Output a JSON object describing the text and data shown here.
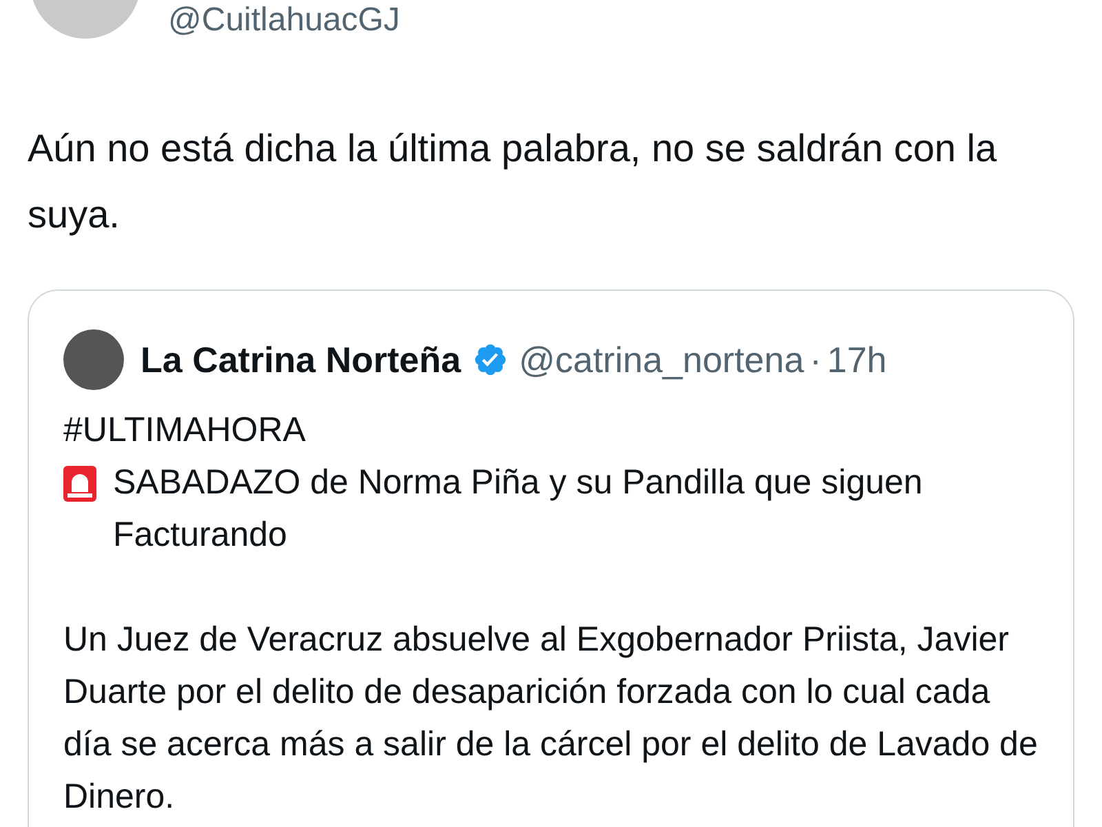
{
  "author": {
    "handle": "@CuitlahuacGJ"
  },
  "tweet_text": "Aún no está dicha la última palabra, no se saldrán con la suya.",
  "quoted": {
    "name": "La Catrina Norteña",
    "verified": true,
    "handle": "@catrina_nortena",
    "separator": "·",
    "time": "17h",
    "paragraphs": [
      {
        "kind": "text",
        "text": "#ULTIMAHORA"
      },
      {
        "kind": "siren",
        "text": "SABADAZO de Norma Piña y su Pandilla que siguen Facturando"
      },
      {
        "kind": "spacer"
      },
      {
        "kind": "text",
        "text": "Un Juez de Veracruz absuelve al Exgobernador Priista, Javier Duarte por el delito de desaparición forzada con lo cual cada día se acerca más a salir de la cárcel por el delito de Lavado de Dinero."
      }
    ]
  }
}
